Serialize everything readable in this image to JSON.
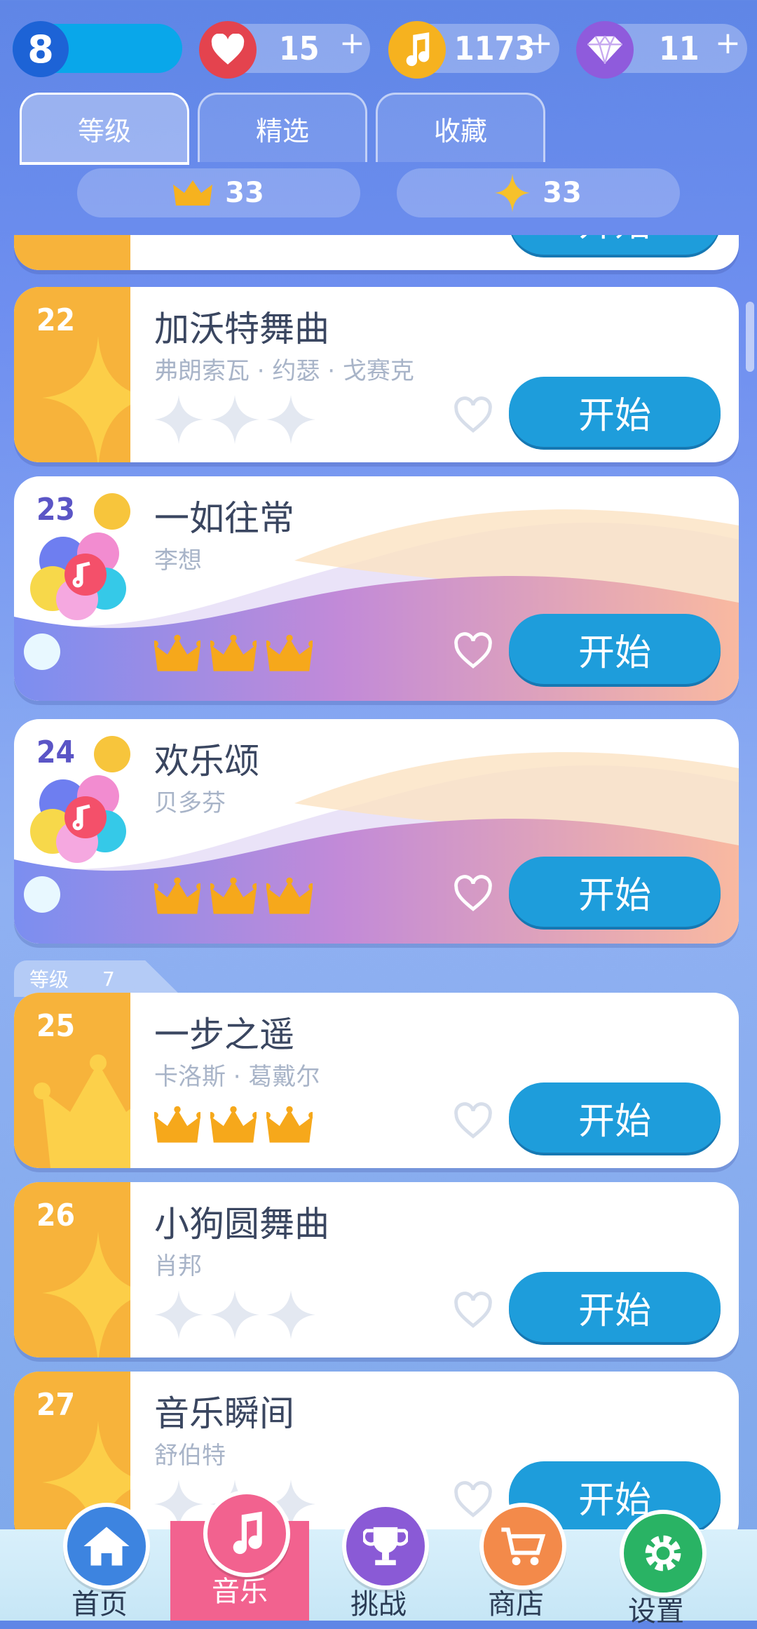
{
  "status": {
    "level": "8",
    "lives": "15",
    "notes": "1173",
    "gems": "11",
    "plus": "+"
  },
  "tabs": [
    {
      "label": "等级",
      "active": true
    },
    {
      "label": "精选",
      "active": false
    },
    {
      "label": "收藏",
      "active": false
    }
  ],
  "counters": {
    "crowns": "33",
    "sparkles": "33"
  },
  "level_tag": {
    "label": "等级",
    "value": "7"
  },
  "songs": [
    {
      "num": "22",
      "title": "加沃特舞曲",
      "artist": "弗朗索瓦 · 约瑟 · 戈赛克",
      "rating": "stars",
      "start": "开始"
    },
    {
      "num": "23",
      "title": "一如往常",
      "artist": "李想",
      "rating": "crowns",
      "start": "开始"
    },
    {
      "num": "24",
      "title": "欢乐颂",
      "artist": "贝多芬",
      "rating": "crowns",
      "start": "开始"
    },
    {
      "num": "25",
      "title": "一步之遥",
      "artist": "卡洛斯 · 葛戴尔",
      "rating": "crowns",
      "start": "开始"
    },
    {
      "num": "26",
      "title": "小狗圆舞曲",
      "artist": "肖邦",
      "rating": "stars",
      "start": "开始"
    },
    {
      "num": "27",
      "title": "音乐瞬间",
      "artist": "舒伯特",
      "rating": "stars",
      "start": "开始"
    }
  ],
  "nav": [
    {
      "label": "首页",
      "icon": "home-icon",
      "color": "#3d84e0"
    },
    {
      "label": "音乐",
      "icon": "music-note-icon",
      "color": "#f2628f"
    },
    {
      "label": "挑战",
      "icon": "trophy-icon",
      "color": "#8a5ad6"
    },
    {
      "label": "商店",
      "icon": "cart-icon",
      "color": "#f38a4a"
    },
    {
      "label": "设置",
      "icon": "gear-icon",
      "color": "#29b364"
    }
  ]
}
